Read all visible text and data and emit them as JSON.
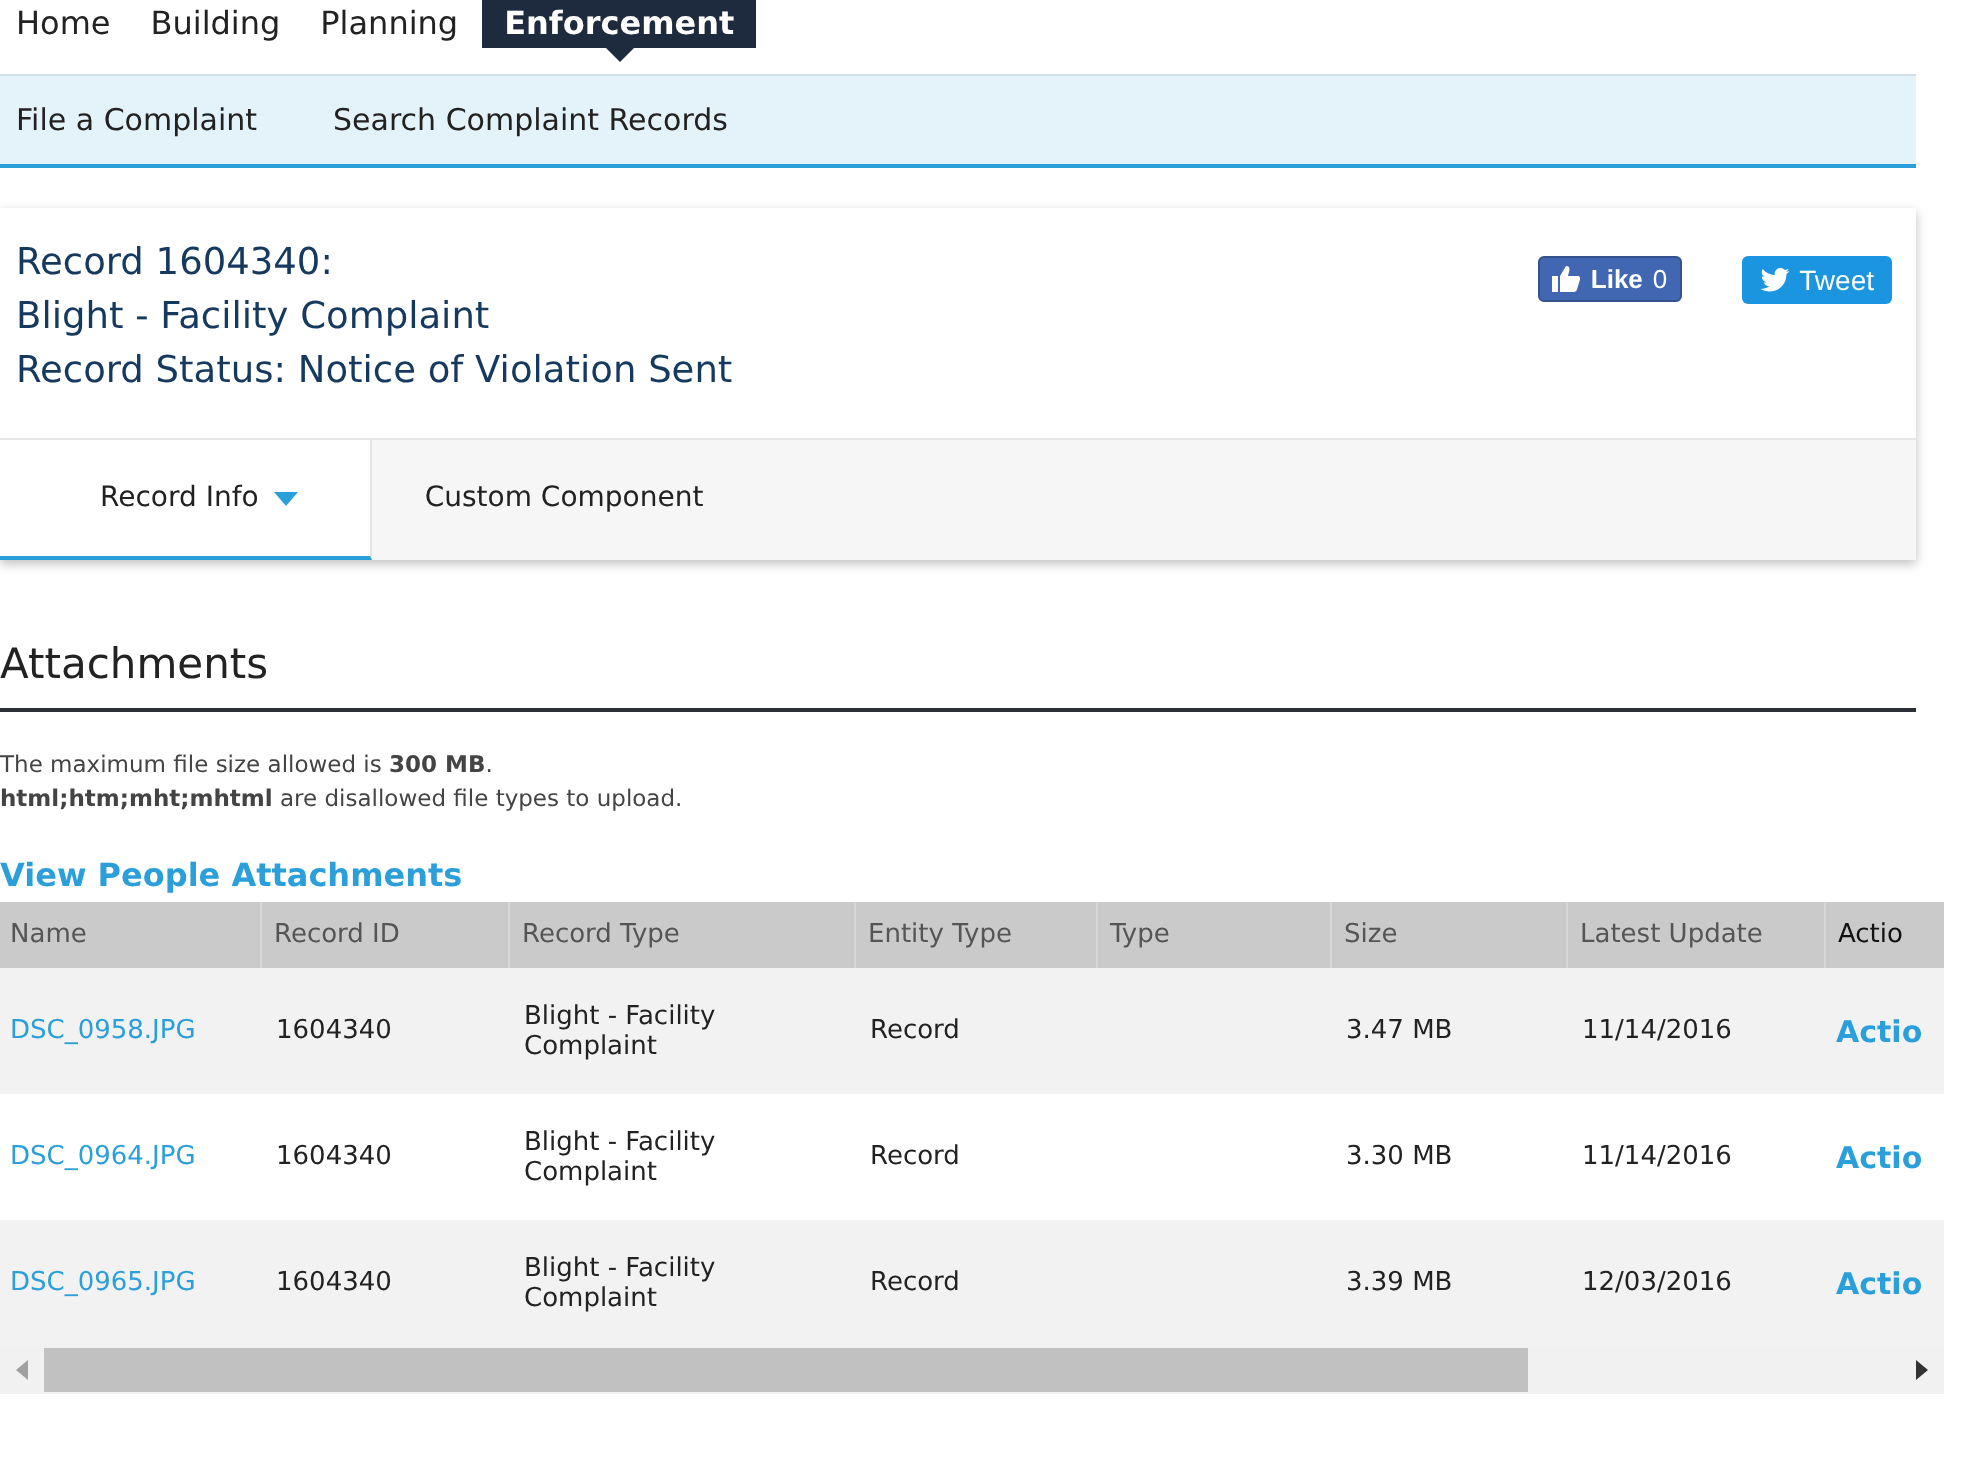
{
  "top_nav": [
    {
      "label": "Home",
      "selected": false
    },
    {
      "label": "Building",
      "selected": false
    },
    {
      "label": "Planning",
      "selected": false
    },
    {
      "label": "Enforcement",
      "selected": true
    }
  ],
  "sub_nav": [
    "File a Complaint",
    "Search Complaint Records"
  ],
  "record": {
    "title": "Record 1604340:",
    "type": "Blight - Facility Complaint",
    "status": "Record Status: Notice of Violation Sent"
  },
  "social": {
    "like_label": "Like",
    "like_count": "0",
    "tweet_label": "Tweet"
  },
  "tabs": [
    {
      "label": "Record Info",
      "selected": true,
      "dropdown": true
    },
    {
      "label": "Custom Component",
      "selected": false,
      "dropdown": false
    }
  ],
  "attachments": {
    "heading": "Attachments",
    "notes": [
      "The maximum file size allowed is **300 MB**.",
      "**html;htm;mht;mhtml** are disallowed file types to upload."
    ],
    "link": "View People Attachments"
  },
  "table": {
    "columns": [
      "Name",
      "Record ID",
      "Record Type",
      "Entity Type",
      "Type",
      "Size",
      "Latest Update",
      "Actio"
    ],
    "rows": [
      {
        "name": "DSC_0958.JPG",
        "record_id": "1604340",
        "record_type": "Blight - Facility Complaint",
        "entity_type": "Record",
        "size": "3.47 MB",
        "latest_update": "11/14/2016",
        "action": "Actio"
      },
      {
        "name": "DSC_0964.JPG",
        "record_id": "1604340",
        "record_type": "Blight - Facility Complaint",
        "entity_type": "Record",
        "size": "3.30 MB",
        "latest_update": "11/14/2016",
        "action": "Actio"
      },
      {
        "name": "DSC_0965.JPG",
        "record_id": "1604340",
        "record_type": "Blight - Facility Complaint",
        "entity_type": "Record",
        "size": "3.39 MB",
        "latest_update": "12/03/2016",
        "action": "Actio"
      }
    ]
  }
}
